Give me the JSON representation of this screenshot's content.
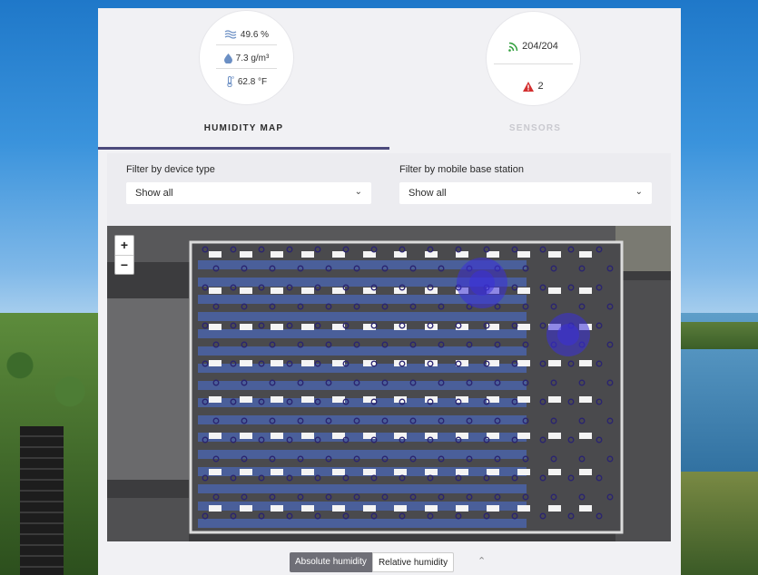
{
  "tabs": [
    {
      "title": "HUMIDITY MAP",
      "metrics": [
        {
          "icon": "waves-icon",
          "value": "49.6 %"
        },
        {
          "icon": "water-drop-icon",
          "value": "7.3 g/m³"
        },
        {
          "icon": "thermometer-icon",
          "value": "62.8 °F"
        }
      ]
    },
    {
      "title": "SENSORS",
      "metrics": [
        {
          "icon": "signal-icon",
          "value": "204/204"
        },
        {
          "icon": "warning-icon",
          "value": "2"
        }
      ]
    }
  ],
  "filters": {
    "device_type": {
      "label": "Filter by device type",
      "value": "Show all"
    },
    "base_station": {
      "label": "Filter by mobile base station",
      "value": "Show all"
    }
  },
  "map": {
    "zoom_in": "+",
    "zoom_out": "−"
  },
  "humidity_toggle": {
    "active": "Absolute humidity",
    "inactive": "Relative humidity"
  },
  "colors": {
    "accent": "#4c4a7c",
    "warning": "#d32f2f",
    "signal": "#2e9e3a"
  }
}
